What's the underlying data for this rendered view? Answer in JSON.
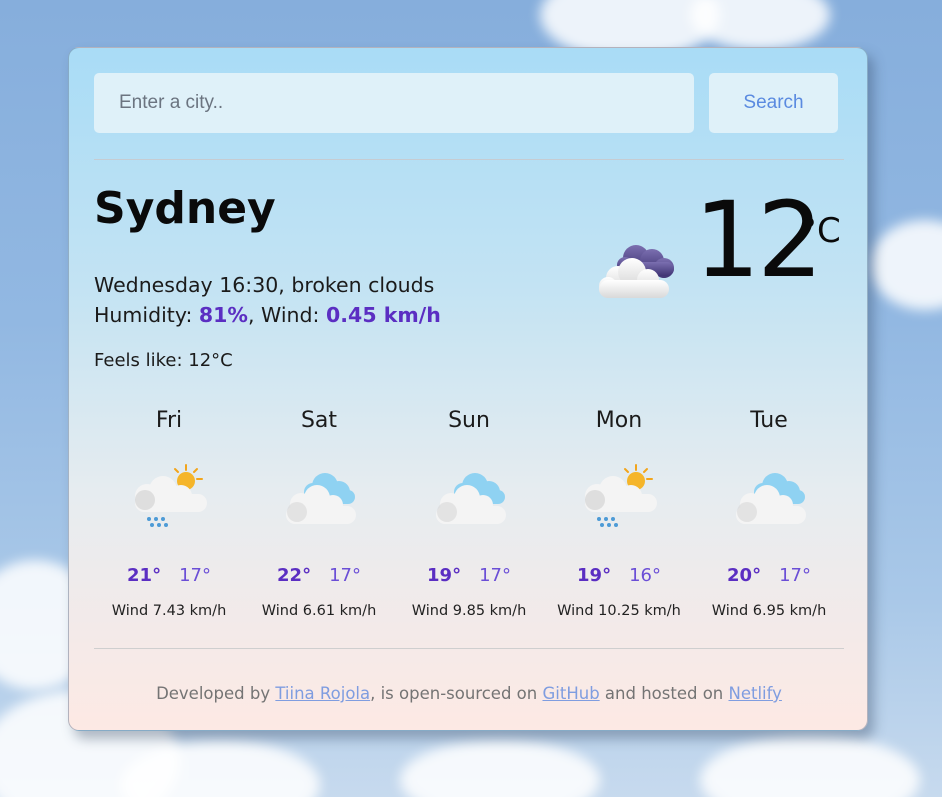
{
  "search": {
    "placeholder": "Enter a city..",
    "button_label": "Search"
  },
  "current": {
    "city": "Sydney",
    "day_time": "Wednesday 16:30",
    "description": "broken clouds",
    "humidity_label": "Humidity:",
    "humidity_value": "81%",
    "wind_label": "Wind:",
    "wind_value": "0.45 km/h",
    "feels_like": "Feels like: 12°C",
    "temperature": "12",
    "unit": "°C",
    "icon": "broken-clouds-icon"
  },
  "forecast": [
    {
      "day": "Fri",
      "max": "21°",
      "min": "17°",
      "wind": "Wind 7.43 km/h",
      "icon": "sun-rain-cloud-icon"
    },
    {
      "day": "Sat",
      "max": "22°",
      "min": "17°",
      "wind": "Wind 6.61 km/h",
      "icon": "cloud-icon"
    },
    {
      "day": "Sun",
      "max": "19°",
      "min": "17°",
      "wind": "Wind 9.85 km/h",
      "icon": "cloud-icon"
    },
    {
      "day": "Mon",
      "max": "19°",
      "min": "16°",
      "wind": "Wind 10.25 km/h",
      "icon": "sun-rain-cloud-icon"
    },
    {
      "day": "Tue",
      "max": "20°",
      "min": "17°",
      "wind": "Wind 6.95 km/h",
      "icon": "cloud-icon"
    }
  ],
  "footer": {
    "prefix": "Developed by",
    "author_link": "Tiina Rojola",
    "middle1": ", is open-sourced on",
    "github_link": "GitHub",
    "middle2": "and hosted on",
    "netlify_link": "Netlify"
  },
  "colors": {
    "accent": "#5b2ec2",
    "link": "#7f9de0",
    "button_text": "#5a8ae0"
  }
}
